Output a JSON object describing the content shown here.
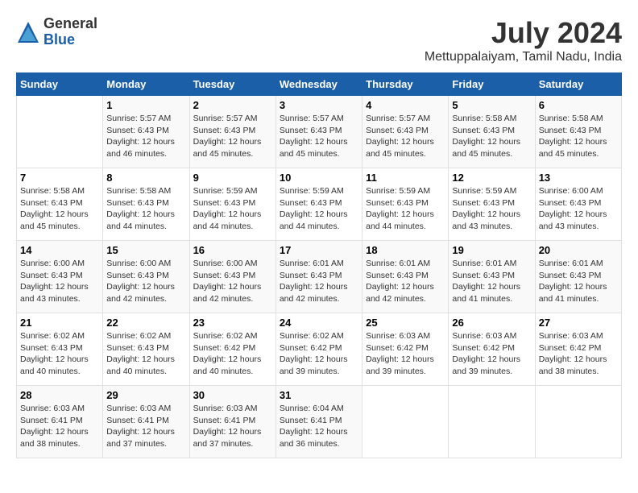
{
  "logo": {
    "general": "General",
    "blue": "Blue"
  },
  "title": "July 2024",
  "subtitle": "Mettuppalaiyam, Tamil Nadu, India",
  "days_header": [
    "Sunday",
    "Monday",
    "Tuesday",
    "Wednesday",
    "Thursday",
    "Friday",
    "Saturday"
  ],
  "weeks": [
    [
      {
        "day": "",
        "content": ""
      },
      {
        "day": "1",
        "content": "Sunrise: 5:57 AM\nSunset: 6:43 PM\nDaylight: 12 hours\nand 46 minutes."
      },
      {
        "day": "2",
        "content": "Sunrise: 5:57 AM\nSunset: 6:43 PM\nDaylight: 12 hours\nand 45 minutes."
      },
      {
        "day": "3",
        "content": "Sunrise: 5:57 AM\nSunset: 6:43 PM\nDaylight: 12 hours\nand 45 minutes."
      },
      {
        "day": "4",
        "content": "Sunrise: 5:57 AM\nSunset: 6:43 PM\nDaylight: 12 hours\nand 45 minutes."
      },
      {
        "day": "5",
        "content": "Sunrise: 5:58 AM\nSunset: 6:43 PM\nDaylight: 12 hours\nand 45 minutes."
      },
      {
        "day": "6",
        "content": "Sunrise: 5:58 AM\nSunset: 6:43 PM\nDaylight: 12 hours\nand 45 minutes."
      }
    ],
    [
      {
        "day": "7",
        "content": "Sunrise: 5:58 AM\nSunset: 6:43 PM\nDaylight: 12 hours\nand 45 minutes."
      },
      {
        "day": "8",
        "content": "Sunrise: 5:58 AM\nSunset: 6:43 PM\nDaylight: 12 hours\nand 44 minutes."
      },
      {
        "day": "9",
        "content": "Sunrise: 5:59 AM\nSunset: 6:43 PM\nDaylight: 12 hours\nand 44 minutes."
      },
      {
        "day": "10",
        "content": "Sunrise: 5:59 AM\nSunset: 6:43 PM\nDaylight: 12 hours\nand 44 minutes."
      },
      {
        "day": "11",
        "content": "Sunrise: 5:59 AM\nSunset: 6:43 PM\nDaylight: 12 hours\nand 44 minutes."
      },
      {
        "day": "12",
        "content": "Sunrise: 5:59 AM\nSunset: 6:43 PM\nDaylight: 12 hours\nand 43 minutes."
      },
      {
        "day": "13",
        "content": "Sunrise: 6:00 AM\nSunset: 6:43 PM\nDaylight: 12 hours\nand 43 minutes."
      }
    ],
    [
      {
        "day": "14",
        "content": "Sunrise: 6:00 AM\nSunset: 6:43 PM\nDaylight: 12 hours\nand 43 minutes."
      },
      {
        "day": "15",
        "content": "Sunrise: 6:00 AM\nSunset: 6:43 PM\nDaylight: 12 hours\nand 42 minutes."
      },
      {
        "day": "16",
        "content": "Sunrise: 6:00 AM\nSunset: 6:43 PM\nDaylight: 12 hours\nand 42 minutes."
      },
      {
        "day": "17",
        "content": "Sunrise: 6:01 AM\nSunset: 6:43 PM\nDaylight: 12 hours\nand 42 minutes."
      },
      {
        "day": "18",
        "content": "Sunrise: 6:01 AM\nSunset: 6:43 PM\nDaylight: 12 hours\nand 42 minutes."
      },
      {
        "day": "19",
        "content": "Sunrise: 6:01 AM\nSunset: 6:43 PM\nDaylight: 12 hours\nand 41 minutes."
      },
      {
        "day": "20",
        "content": "Sunrise: 6:01 AM\nSunset: 6:43 PM\nDaylight: 12 hours\nand 41 minutes."
      }
    ],
    [
      {
        "day": "21",
        "content": "Sunrise: 6:02 AM\nSunset: 6:43 PM\nDaylight: 12 hours\nand 40 minutes."
      },
      {
        "day": "22",
        "content": "Sunrise: 6:02 AM\nSunset: 6:43 PM\nDaylight: 12 hours\nand 40 minutes."
      },
      {
        "day": "23",
        "content": "Sunrise: 6:02 AM\nSunset: 6:42 PM\nDaylight: 12 hours\nand 40 minutes."
      },
      {
        "day": "24",
        "content": "Sunrise: 6:02 AM\nSunset: 6:42 PM\nDaylight: 12 hours\nand 39 minutes."
      },
      {
        "day": "25",
        "content": "Sunrise: 6:03 AM\nSunset: 6:42 PM\nDaylight: 12 hours\nand 39 minutes."
      },
      {
        "day": "26",
        "content": "Sunrise: 6:03 AM\nSunset: 6:42 PM\nDaylight: 12 hours\nand 39 minutes."
      },
      {
        "day": "27",
        "content": "Sunrise: 6:03 AM\nSunset: 6:42 PM\nDaylight: 12 hours\nand 38 minutes."
      }
    ],
    [
      {
        "day": "28",
        "content": "Sunrise: 6:03 AM\nSunset: 6:41 PM\nDaylight: 12 hours\nand 38 minutes."
      },
      {
        "day": "29",
        "content": "Sunrise: 6:03 AM\nSunset: 6:41 PM\nDaylight: 12 hours\nand 37 minutes."
      },
      {
        "day": "30",
        "content": "Sunrise: 6:03 AM\nSunset: 6:41 PM\nDaylight: 12 hours\nand 37 minutes."
      },
      {
        "day": "31",
        "content": "Sunrise: 6:04 AM\nSunset: 6:41 PM\nDaylight: 12 hours\nand 36 minutes."
      },
      {
        "day": "",
        "content": ""
      },
      {
        "day": "",
        "content": ""
      },
      {
        "day": "",
        "content": ""
      }
    ]
  ]
}
